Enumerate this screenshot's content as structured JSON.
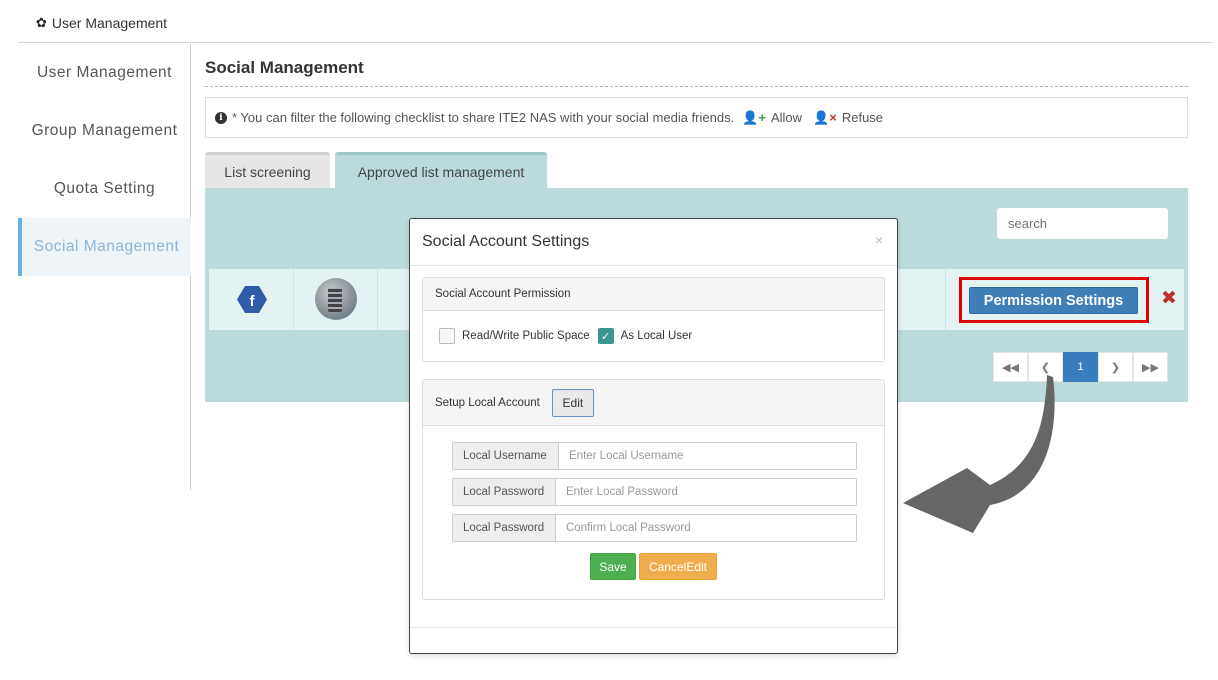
{
  "topbar": {
    "icon": "gear-icon",
    "title": "User Management"
  },
  "sidebar": {
    "items": [
      {
        "label": "User Management",
        "active": false
      },
      {
        "label": "Group Management",
        "active": false
      },
      {
        "label": "Quota Setting",
        "active": false
      },
      {
        "label": "Social Management",
        "active": true
      }
    ]
  },
  "main": {
    "title": "Social Management",
    "notice": {
      "text": "* You can filter the following checklist to share ITE2 NAS with your social media friends.",
      "allow_label": "Allow",
      "refuse_label": "Refuse"
    },
    "tabs": [
      {
        "label": "List screening",
        "active": false
      },
      {
        "label": "Approved list management",
        "active": true
      }
    ],
    "search": {
      "placeholder": "search",
      "value": ""
    },
    "rows": [
      {
        "platform": "facebook",
        "avatar": "user-avatar",
        "action_label": "Permission Settings"
      }
    ],
    "pagination": {
      "first": "«",
      "prev": "‹",
      "current": "1",
      "next": "›",
      "last": "»"
    }
  },
  "modal": {
    "title": "Social Account Settings",
    "close": "×",
    "permission": {
      "heading": "Social Account Permission",
      "options": [
        {
          "label": "Read/Write Public Space",
          "checked": false
        },
        {
          "label": "As Local User",
          "checked": true
        }
      ]
    },
    "local_account": {
      "heading": "Setup Local Account",
      "edit_label": "Edit",
      "fields": [
        {
          "label": "Local Username",
          "placeholder": "Enter Local Username",
          "value": ""
        },
        {
          "label": "Local Password",
          "placeholder": "Enter Local Password",
          "value": ""
        },
        {
          "label": "Local Password",
          "placeholder": "Confirm Local Password",
          "value": ""
        }
      ],
      "save_label": "Save",
      "cancel_label": "CancelEdit"
    }
  },
  "colors": {
    "accent": "#3e7fb8",
    "panel_bg": "#bcdadb",
    "highlight_box": "#e00000",
    "save": "#4caf50",
    "cancel": "#f0ad4e",
    "allow": "#3a9c3a",
    "refuse": "#b83c3c",
    "checked": "#3a9790"
  }
}
